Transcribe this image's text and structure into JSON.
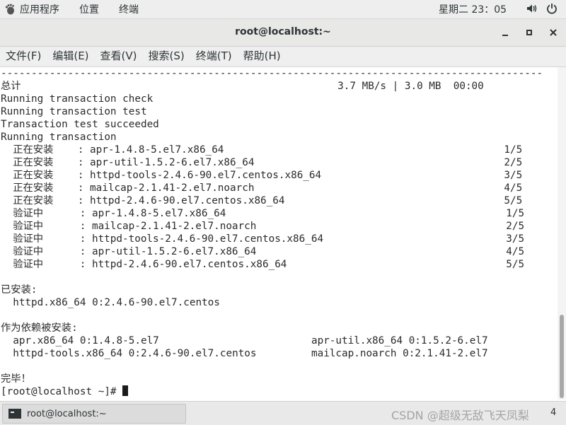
{
  "topbar": {
    "apps": "应用程序",
    "places": "位置",
    "terminal": "终端",
    "clock": "星期二 23：05",
    "icons": [
      "volume-icon",
      "power-icon"
    ]
  },
  "window": {
    "title": "root@localhost:~",
    "minimize": "–",
    "maximize": "▫",
    "close": "×"
  },
  "menu": [
    "文件(F)",
    "编辑(E)",
    "查看(V)",
    "搜索(S)",
    "终端(T)",
    "帮助(H)"
  ],
  "terminal": {
    "lines": [
      "-----------------------------------------------------------------------------------------",
      "总计                                                    3.7 MB/s | 3.0 MB  00:00",
      "Running transaction check",
      "Running transaction test",
      "Transaction test succeeded",
      "Running transaction",
      "  正在安装    : apr-1.4.8-5.el7.x86_64                                              1/5",
      "  正在安装    : apr-util-1.5.2-6.el7.x86_64                                         2/5",
      "  正在安装    : httpd-tools-2.4.6-90.el7.centos.x86_64                              3/5",
      "  正在安装    : mailcap-2.1.41-2.el7.noarch                                         4/5",
      "  正在安装    : httpd-2.4.6-90.el7.centos.x86_64                                    5/5",
      "  验证中      : apr-1.4.8-5.el7.x86_64                                              1/5",
      "  验证中      : mailcap-2.1.41-2.el7.noarch                                         2/5",
      "  验证中      : httpd-tools-2.4.6-90.el7.centos.x86_64                              3/5",
      "  验证中      : apr-util-1.5.2-6.el7.x86_64                                         4/5",
      "  验证中      : httpd-2.4.6-90.el7.centos.x86_64                                    5/5",
      "",
      "已安装:",
      "  httpd.x86_64 0:2.4.6-90.el7.centos",
      "",
      "作为依赖被安装:",
      "  apr.x86_64 0:1.4.8-5.el7                         apr-util.x86_64 0:1.5.2-6.el7",
      "  httpd-tools.x86_64 0:2.4.6-90.el7.centos         mailcap.noarch 0:2.1.41-2.el7",
      "",
      "完毕！"
    ],
    "prompt": "[root@localhost ~]# "
  },
  "taskbar": {
    "item_label": "root@localhost:~",
    "watermark": "CSDN @超级无敌飞天凤梨",
    "workspace": "4"
  }
}
